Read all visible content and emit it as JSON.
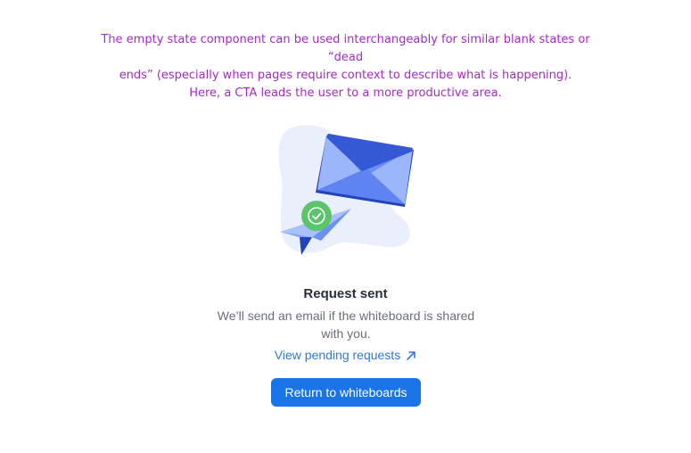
{
  "annotation": {
    "line1": "The empty state component can be used interchangeably for similar blank states or “dead",
    "line2": "ends” (especially when pages require context to describe what is happening).",
    "line3": "Here, a CTA leads the user to a more productive area."
  },
  "empty_state": {
    "illustration_icon": "envelope-paper-plane-check-illustration",
    "title": "Request sent",
    "description": "We’ll send an email if the whiteboard is shared with you.",
    "link_label": "View pending requests",
    "link_icon": "arrow-up-right-icon",
    "cta_label": "Return to whiteboards"
  },
  "colors": {
    "annotation": "#a52bc6",
    "primary": "#1a74e8",
    "link": "#2e7ad8",
    "success": "#5cc46b"
  }
}
